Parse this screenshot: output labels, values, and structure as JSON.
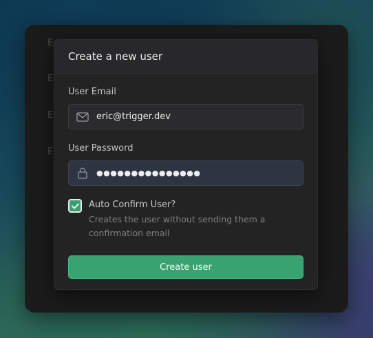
{
  "background_panel": {
    "labels": [
      "E",
      "E",
      "E",
      "E"
    ]
  },
  "dialog": {
    "title": "Create a new user",
    "email": {
      "label": "User Email",
      "value": "eric@trigger.dev",
      "icon": "mail-icon"
    },
    "password": {
      "label": "User Password",
      "value": "●●●●●●●●●●●●●●●",
      "icon": "lock-icon"
    },
    "auto_confirm": {
      "checked": true,
      "label": "Auto Confirm User?",
      "description": "Creates the user without sending them a confirmation email"
    },
    "submit_label": "Create user"
  },
  "colors": {
    "accent": "#38a270",
    "dialog_bg": "#232324",
    "panel_bg": "#1b1b1c"
  }
}
